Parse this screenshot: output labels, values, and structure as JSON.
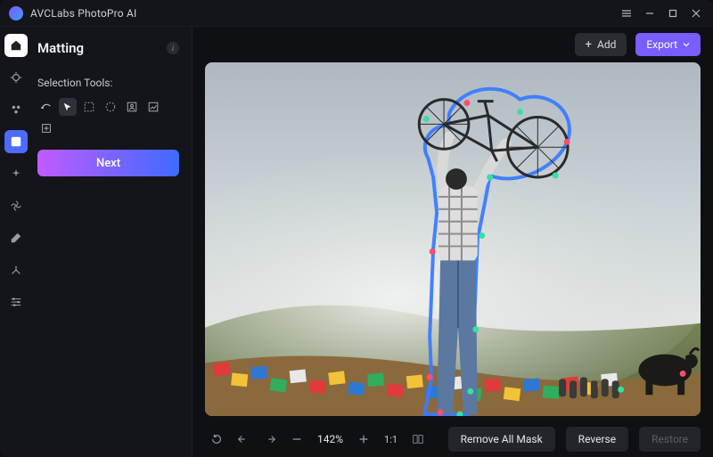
{
  "titlebar": {
    "app_name": "AVCLabs PhotoPro AI"
  },
  "rail": {
    "items": [
      {
        "name": "home"
      },
      {
        "name": "enhance"
      },
      {
        "name": "ai-tools"
      },
      {
        "name": "matting"
      },
      {
        "name": "magic"
      },
      {
        "name": "effects"
      },
      {
        "name": "color"
      },
      {
        "name": "crop"
      },
      {
        "name": "settings"
      }
    ],
    "active_index": 3
  },
  "panel": {
    "title": "Matting",
    "section_label": "Selection Tools:",
    "tools": [
      "brush",
      "lasso",
      "marquee-rect",
      "marquee-ellipse",
      "portrait",
      "object",
      "expand"
    ],
    "active_tool_index": 1,
    "next_label": "Next"
  },
  "toolbar": {
    "add_label": "Add",
    "export_label": "Export"
  },
  "bottombar": {
    "zoom_label": "142%",
    "ratio_label": "1:1",
    "remove_label": "Remove All Mask",
    "reverse_label": "Reverse",
    "restore_label": "Restore"
  }
}
